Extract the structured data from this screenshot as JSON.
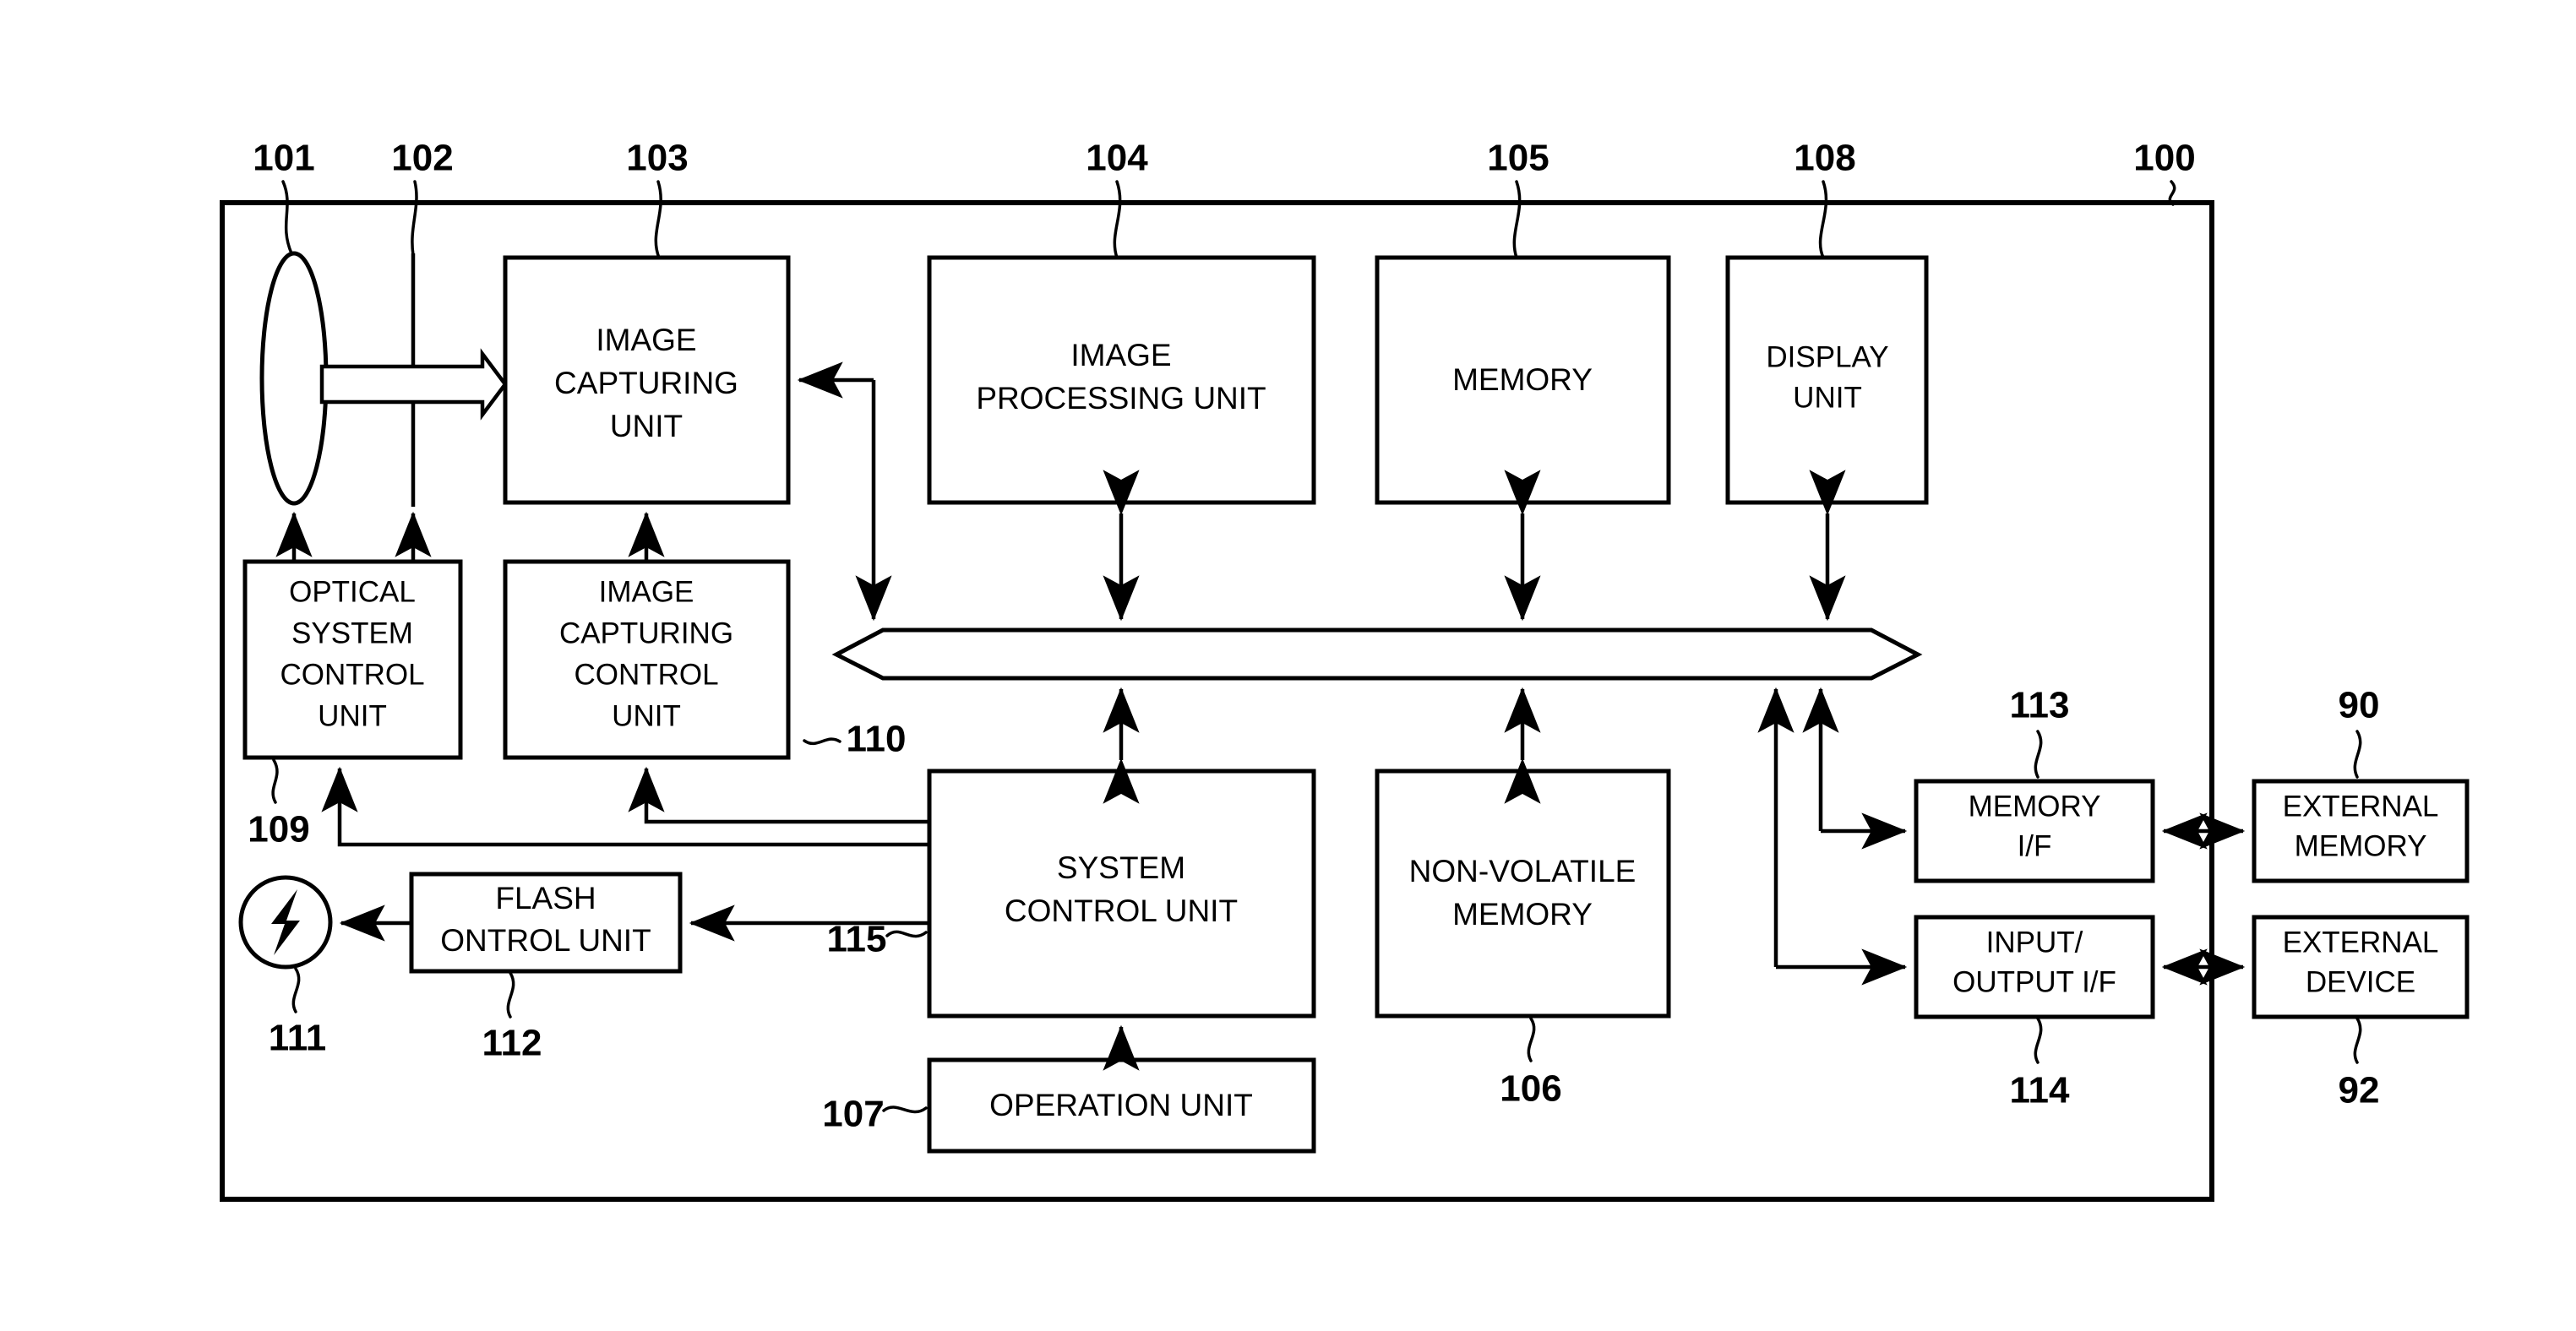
{
  "figure": {
    "title": "Image capturing apparatus block diagram",
    "device_frame_ref": "100"
  },
  "blocks": {
    "image_capturing_unit": {
      "ref": "103",
      "line1": "IMAGE",
      "line2": "CAPTURING",
      "line3": "UNIT"
    },
    "image_processing_unit": {
      "ref": "104",
      "line1": "IMAGE",
      "line2": "PROCESSING UNIT"
    },
    "memory": {
      "ref": "105",
      "line1": "MEMORY"
    },
    "display_unit": {
      "ref": "108",
      "line1": "DISPLAY",
      "line2": "UNIT"
    },
    "optical_system_control_unit": {
      "ref": "109",
      "line1": "OPTICAL",
      "line2": "SYSTEM",
      "line3": "CONTROL",
      "line4": "UNIT"
    },
    "image_capturing_control_unit": {
      "ref": "110",
      "line1": "IMAGE",
      "line2": "CAPTURING",
      "line3": "CONTROL",
      "line4": "UNIT"
    },
    "flash_control_unit": {
      "ref": "112",
      "line1": "FLASH",
      "line2": "ONTROL UNIT"
    },
    "system_control_unit": {
      "ref": "115",
      "line1": "SYSTEM",
      "line2": "CONTROL UNIT"
    },
    "non_volatile_memory": {
      "ref": "106",
      "line1": "NON-VOLATILE",
      "line2": "MEMORY"
    },
    "operation_unit": {
      "ref": "107",
      "line1": "OPERATION UNIT"
    },
    "memory_if": {
      "ref": "113",
      "line1": "MEMORY",
      "line2": "I/F"
    },
    "input_output_if": {
      "ref": "114",
      "line1": "INPUT/",
      "line2": "OUTPUT I/F"
    },
    "external_memory": {
      "ref": "90",
      "line1": "EXTERNAL",
      "line2": "MEMORY"
    },
    "external_device": {
      "ref": "92",
      "line1": "EXTERNAL",
      "line2": "DEVICE"
    },
    "optical_system": {
      "ref": "101"
    },
    "aperture_shutter": {
      "ref": "102"
    },
    "flash_lamp": {
      "ref": "111"
    }
  },
  "refs": {
    "r100": "100",
    "r101": "101",
    "r102": "102",
    "r103": "103",
    "r104": "104",
    "r105": "105",
    "r106": "106",
    "r107": "107",
    "r108": "108",
    "r109": "109",
    "r110": "110",
    "r111": "111",
    "r112": "112",
    "r113": "113",
    "r114": "114",
    "r115": "115",
    "r90": "90",
    "r92": "92"
  },
  "colors": {
    "stroke": "#000000",
    "background": "#ffffff"
  }
}
